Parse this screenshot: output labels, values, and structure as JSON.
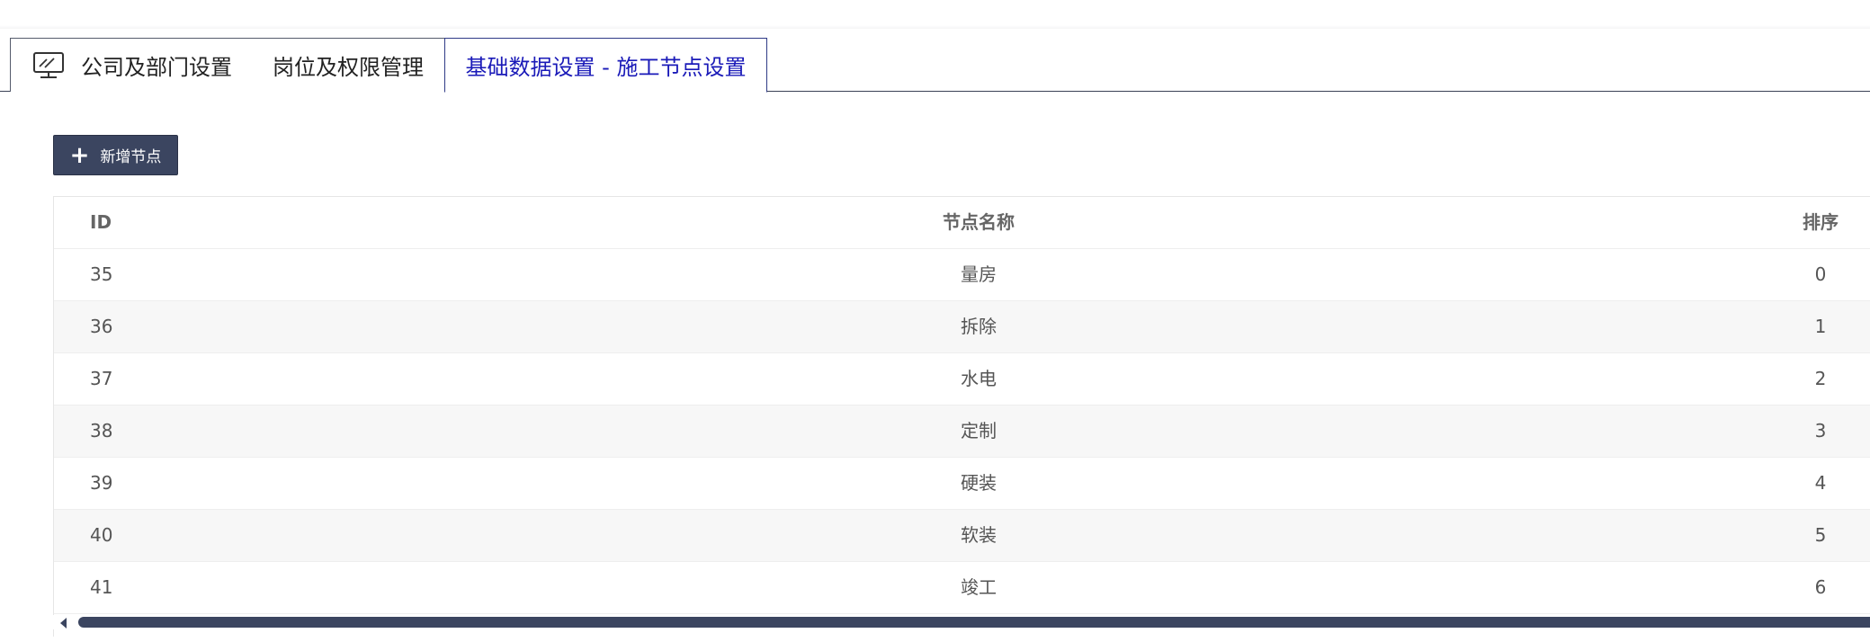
{
  "tabs": [
    {
      "label": "公司及部门设置",
      "icon": "monitor-icon"
    },
    {
      "label": "岗位及权限管理"
    },
    {
      "label": "基础数据设置 - 施工节点设置"
    }
  ],
  "toolbar": {
    "add_label": "新增节点",
    "add_icon": "plus-icon"
  },
  "table": {
    "headers": {
      "id": "ID",
      "name": "节点名称",
      "sort": "排序"
    },
    "rows": [
      {
        "id": "35",
        "name": "量房",
        "sort": "0"
      },
      {
        "id": "36",
        "name": "拆除",
        "sort": "1"
      },
      {
        "id": "37",
        "name": "水电",
        "sort": "2"
      },
      {
        "id": "38",
        "name": "定制",
        "sort": "3"
      },
      {
        "id": "39",
        "name": "硬装",
        "sort": "4"
      },
      {
        "id": "40",
        "name": "软装",
        "sort": "5"
      },
      {
        "id": "41",
        "name": "竣工",
        "sort": "6"
      }
    ]
  },
  "colors": {
    "accent": "#3b4560",
    "active_tab_text": "#1a1ab8"
  }
}
